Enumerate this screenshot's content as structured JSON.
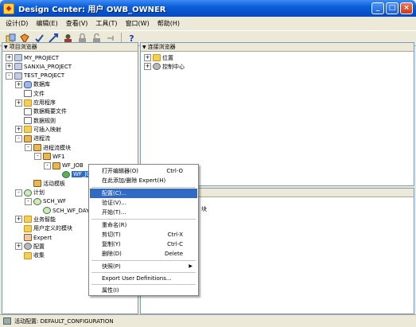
{
  "window": {
    "title": "Design Center: 用户 OWB_OWNER",
    "buttons": {
      "minimize": "_",
      "maximize": "□",
      "close": "×"
    }
  },
  "menubar": [
    {
      "label": "设计(D)"
    },
    {
      "label": "编辑(E)"
    },
    {
      "label": "查看(V)"
    },
    {
      "label": "工具(T)"
    },
    {
      "label": "窗口(W)"
    },
    {
      "label": "帮助(H)"
    }
  ],
  "toolbar": {
    "icons": [
      "new-icon",
      "properties-icon",
      "validate-icon",
      "deploy-icon",
      "user-icon",
      "locked-icon",
      "unlocked-icon",
      "pin-icon",
      "help-icon"
    ]
  },
  "project_explorer": {
    "header": "项目浏览器",
    "nodes": [
      {
        "label": "MY_PROJECT",
        "toggle": "+",
        "icon": "proj"
      },
      {
        "label": "SANXIA_PROJECT",
        "toggle": "+",
        "icon": "proj"
      },
      {
        "label": "TEST_PROJECT",
        "toggle": "-",
        "icon": "proj"
      },
      {
        "label": "数据库",
        "toggle": "+",
        "icon": "db"
      },
      {
        "label": "文件",
        "toggle": "",
        "icon": "file"
      },
      {
        "label": "应用程序",
        "toggle": "+",
        "icon": "folder"
      },
      {
        "label": "数据概要文件",
        "toggle": "",
        "icon": "file"
      },
      {
        "label": "数据规则",
        "toggle": "",
        "icon": "file"
      },
      {
        "label": "可插入映射",
        "toggle": "+",
        "icon": "folder"
      },
      {
        "label": "进程流",
        "toggle": "-",
        "icon": "flow"
      },
      {
        "label": "进程流模块",
        "toggle": "-",
        "icon": "flow"
      },
      {
        "label": "WF1",
        "toggle": "-",
        "icon": "flow"
      },
      {
        "label": "WF_JOB",
        "toggle": "-",
        "icon": "flow"
      },
      {
        "label": "WF_JOB",
        "toggle": "",
        "icon": "job",
        "selected": true
      },
      {
        "label": "活动模板",
        "toggle": "",
        "icon": "flow"
      },
      {
        "label": "计划",
        "toggle": "-",
        "icon": "clock"
      },
      {
        "label": "SCH_WF",
        "toggle": "-",
        "icon": "clock"
      },
      {
        "label": "SCH_WF_DAY",
        "toggle": "",
        "icon": "clock"
      },
      {
        "label": "业务智能",
        "toggle": "+",
        "icon": "folder"
      },
      {
        "label": "用户定义的模块",
        "toggle": "",
        "icon": "folder"
      },
      {
        "label": "Expert",
        "toggle": "",
        "icon": "user"
      },
      {
        "label": "配置",
        "toggle": "+",
        "icon": "gear"
      },
      {
        "label": "收集",
        "toggle": "",
        "icon": "folder"
      }
    ]
  },
  "connection_explorer": {
    "header": "连接浏览器",
    "nodes": [
      {
        "label": "位置",
        "toggle": "+",
        "icon": "folder"
      },
      {
        "label": "控制中心",
        "toggle": "+",
        "icon": "gear"
      }
    ]
  },
  "lower_panel": {
    "partial_text": "块"
  },
  "context_menu": {
    "items": [
      {
        "label": "打开编辑器(O)",
        "shortcut": "Ctrl-O"
      },
      {
        "label": "在此添加/删除 Expert(H)",
        "shortcut": ""
      },
      {
        "sep": true
      },
      {
        "label": "配置(C)...",
        "shortcut": "",
        "active": true
      },
      {
        "label": "验证(V)...",
        "shortcut": ""
      },
      {
        "label": "开始(T)...",
        "shortcut": ""
      },
      {
        "sep": true
      },
      {
        "label": "重命名(R)",
        "shortcut": ""
      },
      {
        "label": "剪切(T)",
        "shortcut": "Ctrl-X"
      },
      {
        "label": "复制(Y)",
        "shortcut": "Ctrl-C"
      },
      {
        "label": "删除(D)",
        "shortcut": "Delete"
      },
      {
        "sep": true
      },
      {
        "label": "快照(P)",
        "shortcut": "",
        "submenu": true
      },
      {
        "sep": true
      },
      {
        "label": "Export User Definitions...",
        "shortcut": ""
      },
      {
        "sep": true
      },
      {
        "label": "属性(I)",
        "shortcut": ""
      }
    ]
  },
  "statusbar": {
    "text": "活动配置: DEFAULT_CONFIGURATION"
  },
  "colors": {
    "titlebar": "#0a5fd8",
    "selection": "#316ac5",
    "chrome": "#ece9d8"
  }
}
